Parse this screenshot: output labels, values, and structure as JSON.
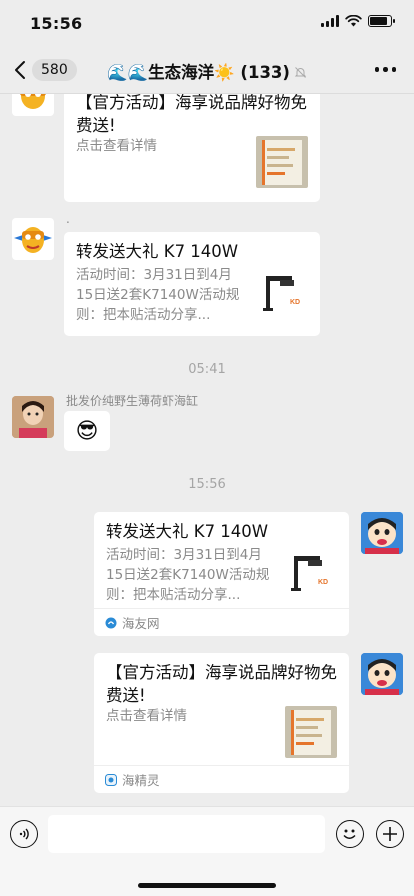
{
  "status_bar": {
    "time": "15:56"
  },
  "nav": {
    "back_count": "580",
    "title": "🌊🌊生态海洋☀️ (133)"
  },
  "messages": {
    "msg1": {
      "title": "【官方活动】海享说品牌好物免费送!",
      "desc": "点击查看详情"
    },
    "msg2": {
      "sender": ".",
      "title": "转发送大礼 K7 140W",
      "desc": "活动时间：3月31日到4月15日送2套K7140W活动规则：把本贴活动分享..."
    },
    "time1": "05:41",
    "msg3": {
      "sender": "批发价纯野生薄荷虾海缸",
      "emoji": "😎"
    },
    "time2": "15:56",
    "msg4": {
      "title": "转发送大礼 K7 140W",
      "desc": "活动时间：3月31日到4月15日送2套K7140W活动规则：把本贴活动分享...",
      "source": "海友网"
    },
    "msg5": {
      "title": "【官方活动】海享说品牌好物免费送!",
      "desc": "点击查看详情",
      "source": "海精灵"
    }
  },
  "thumb_text": "KD",
  "colors": {
    "accent": "#e5752c",
    "chat_bg": "#ededed",
    "source_icon": "#2a8bd6"
  }
}
